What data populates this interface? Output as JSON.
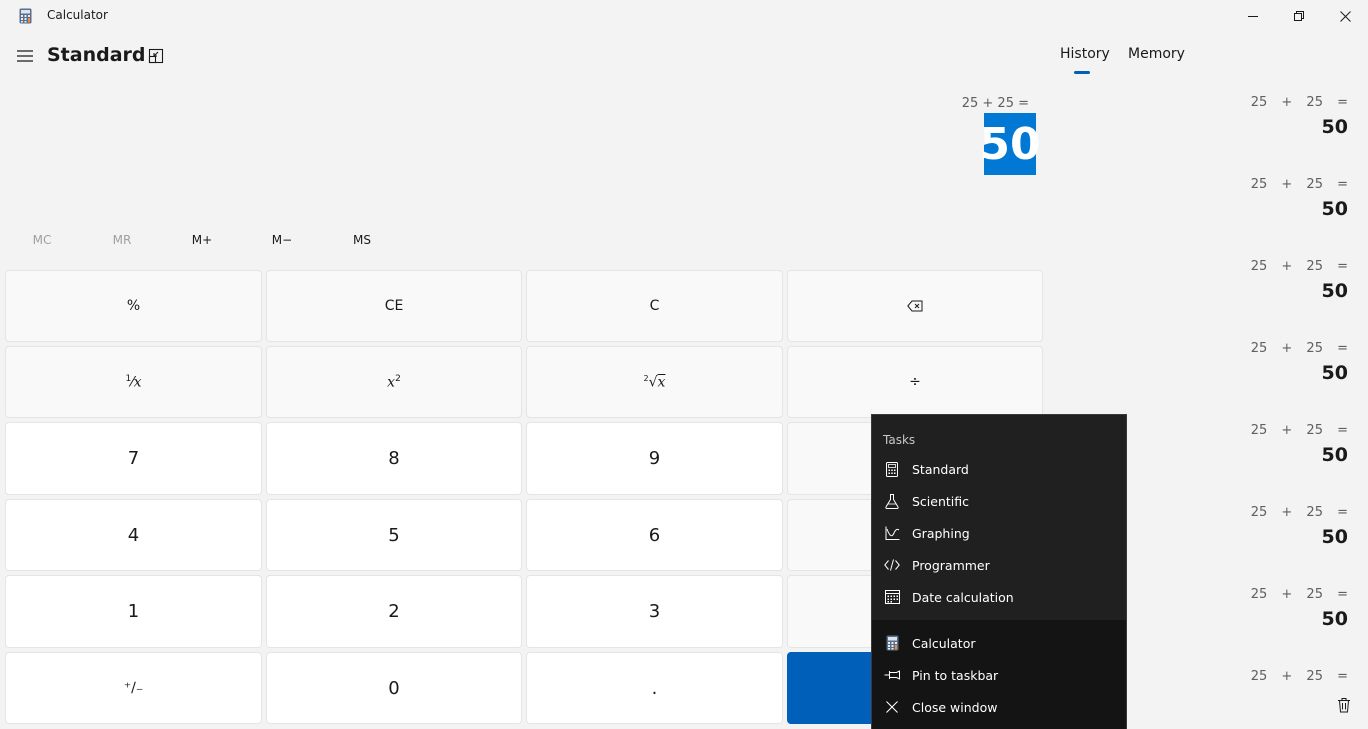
{
  "app": {
    "title": "Calculator"
  },
  "header": {
    "mode": "Standard"
  },
  "tabs": {
    "history": "History",
    "memory": "Memory"
  },
  "display": {
    "expression": "25 + 25 =",
    "result": "50"
  },
  "memory_buttons": [
    "MC",
    "MR",
    "M+",
    "M−",
    "MS"
  ],
  "keys": {
    "percent": "%",
    "ce": "CE",
    "c": "C",
    "divide": "÷",
    "seven": "7",
    "eight": "8",
    "nine": "9",
    "four": "4",
    "five": "5",
    "six": "6",
    "one": "1",
    "two": "2",
    "three": "3",
    "zero": "0",
    "decimal": ".",
    "reciprocal_num": "1",
    "reciprocal_den": "x",
    "square_base": "x",
    "square_exp": "2",
    "root_index": "2",
    "root_base": "x",
    "negate": "⁺∕₋"
  },
  "history": {
    "items": [
      {
        "expression": "25 + 25 =",
        "result": "50"
      },
      {
        "expression": "25 + 25 =",
        "result": "50"
      },
      {
        "expression": "25 + 25 =",
        "result": "50"
      },
      {
        "expression": "25 + 25 =",
        "result": "50"
      },
      {
        "expression": "25 + 25 =",
        "result": "50"
      },
      {
        "expression": "25 + 25 =",
        "result": "50"
      },
      {
        "expression": "25 + 25 =",
        "result": "50"
      },
      {
        "expression": "25 + 25 =",
        "result": ""
      }
    ]
  },
  "jumplist": {
    "tasks_header": "Tasks",
    "tasks": [
      {
        "label": "Standard",
        "icon": "calculator-icon"
      },
      {
        "label": "Scientific",
        "icon": "flask-icon"
      },
      {
        "label": "Graphing",
        "icon": "graph-icon"
      },
      {
        "label": "Programmer",
        "icon": "code-icon"
      },
      {
        "label": "Date calculation",
        "icon": "calendar-icon"
      }
    ],
    "app_label": "Calculator",
    "pin_label": "Pin to taskbar",
    "close_label": "Close window"
  },
  "colors": {
    "accent": "#005fb8",
    "result_highlight": "#0078d4",
    "jumplist_bg": "#202020"
  }
}
